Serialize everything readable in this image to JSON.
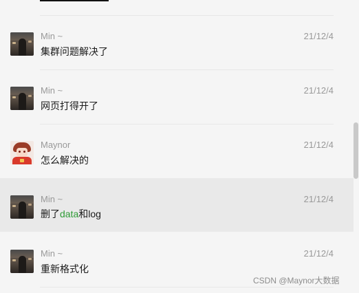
{
  "messages": [
    {
      "sender": "Min ~",
      "date": "21/12/4",
      "text": "集群问题解决了",
      "avatar_icon": "avatar-night-photo"
    },
    {
      "sender": "Min ~",
      "date": "21/12/4",
      "text": "网页打得开了",
      "avatar_icon": "avatar-night-photo"
    },
    {
      "sender": "Maynor",
      "date": "21/12/4",
      "text": "怎么解决的",
      "avatar_icon": "avatar-anime-character"
    },
    {
      "sender": "Min ~",
      "date": "21/12/4",
      "text_parts": [
        "删了",
        "data",
        "和log"
      ],
      "highlight_color": "#2e9b36",
      "avatar_icon": "avatar-night-photo",
      "selected": true
    },
    {
      "sender": "Min ~",
      "date": "21/12/4",
      "text": "重新格式化",
      "avatar_icon": "avatar-night-photo"
    }
  ],
  "watermark": "CSDN @Maynor大数据",
  "colors": {
    "background": "#f5f5f5",
    "selected_row": "#e9e9e9",
    "meta_text": "#999999",
    "body_text": "#1a1a1a",
    "keyword": "#2e9b36"
  }
}
